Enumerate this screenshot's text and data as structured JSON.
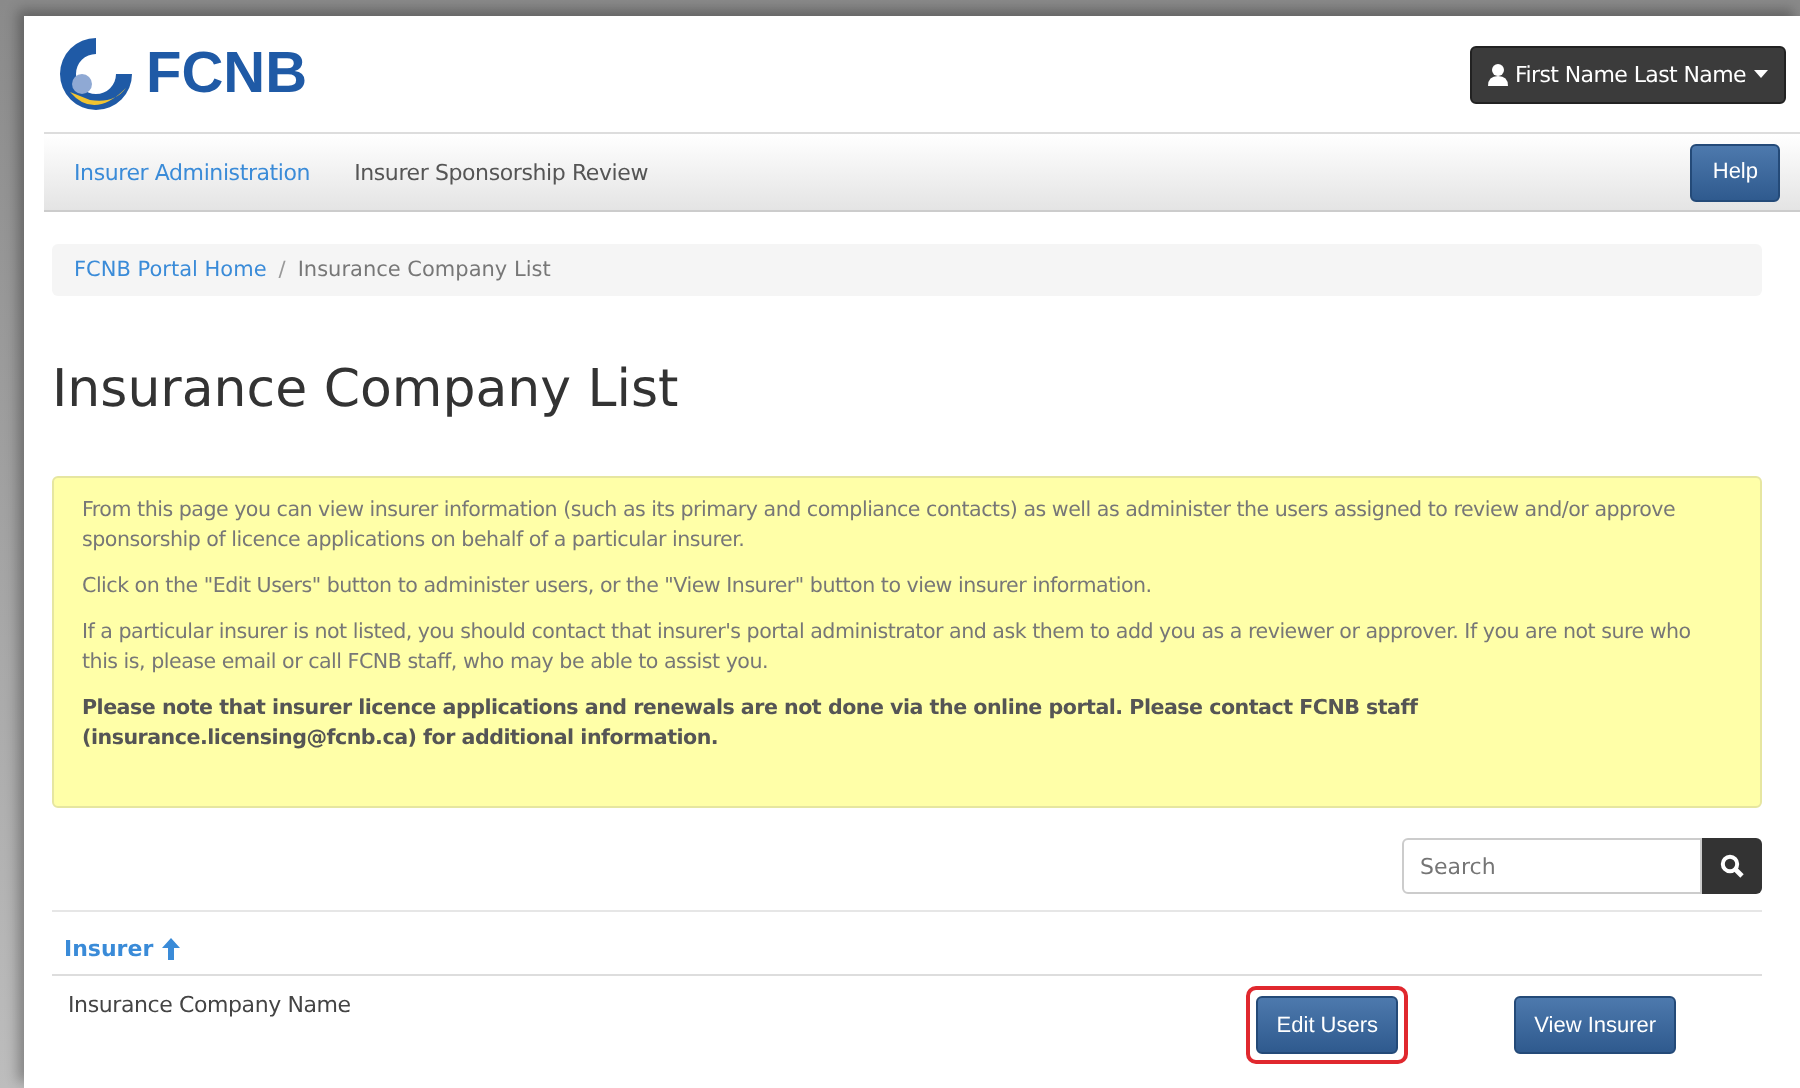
{
  "header": {
    "logo": "FCNB",
    "user_menu": "First Name Last Name"
  },
  "nav": {
    "items": [
      {
        "label": "Insurer Administration",
        "selected": true
      },
      {
        "label": "Insurer Sponsorship Review",
        "selected": false
      }
    ],
    "help": "Help"
  },
  "breadcrumb": [
    {
      "label": "FCNB Portal Home",
      "link": true
    },
    {
      "label": "Insurance Company List",
      "link": false
    }
  ],
  "breadcrumb_separator": "/",
  "heading": "Insurance Company List",
  "notice": [
    "From this page you can view insurer information (such as its primary and compliance contacts) as well as administer the users assigned to review and/or approve sponsorship of licence applications on behalf of a particular insurer.",
    "Click on the \"Edit Users\" button to administer users, or the \"View Insurer\" button to view insurer information.",
    "If a particular insurer is not listed, you should contact that insurer's portal administrator and ask them to add you as a reviewer or approver. If you are not sure who this is, please email or call FCNB staff, who may be able to assist you.",
    "**Please note that insurer licence applications and renewals are not done via the online portal. Please contact FCNB staff (insurance.licensing@fcnb.ca) for additional information.**"
  ],
  "search": {
    "placeholder": "Search"
  },
  "table": {
    "column": "Insurer",
    "sort_ascending": true,
    "rows": [
      {
        "name": "Insurance Company Name",
        "buttons": [
          {
            "label": "Edit Users",
            "highlighted": true
          },
          {
            "label": "View Insurer",
            "highlighted": false
          }
        ]
      }
    ]
  }
}
